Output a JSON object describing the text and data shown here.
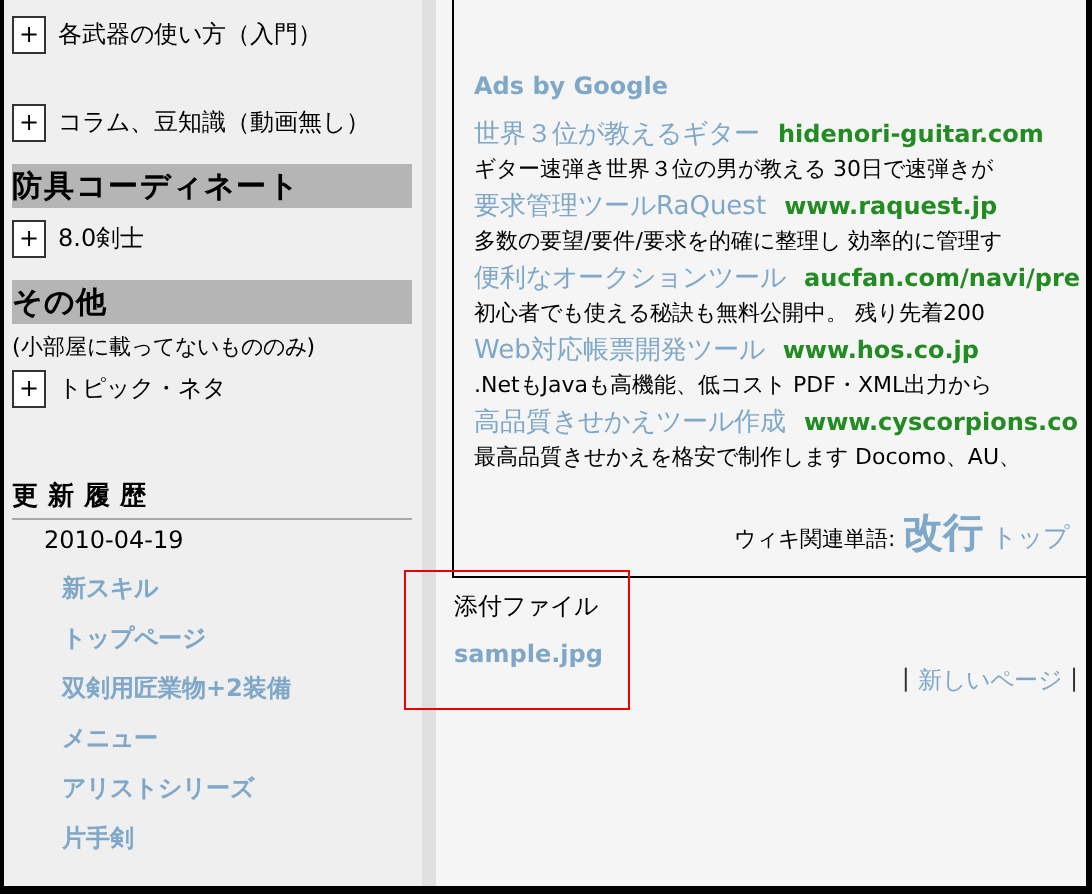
{
  "sidebar": {
    "blocks": [
      {
        "kind": "expander",
        "toggle": "+",
        "label": "各武器の使い方（入門）"
      },
      {
        "kind": "expander",
        "toggle": "+",
        "label": "コラム、豆知識（動画無し）"
      },
      {
        "kind": "heading",
        "label": "防具コーディネート"
      },
      {
        "kind": "expander",
        "toggle": "+",
        "label": "8.0剣士"
      },
      {
        "kind": "heading",
        "label": "その他"
      },
      {
        "kind": "note",
        "label": "(小部屋に載ってないもののみ)"
      },
      {
        "kind": "expander",
        "toggle": "+",
        "label": "トピック・ネタ"
      }
    ],
    "history": {
      "title": "更新履歴",
      "date": "2010-04-19",
      "links": [
        "新スキル",
        "トップページ",
        "双剣用匠業物+2装備",
        "メニュー",
        "アリストシリーズ",
        "片手剣"
      ]
    }
  },
  "ads": {
    "label": "Ads by Google",
    "items": [
      {
        "title": "世界３位が教えるギター",
        "url": "hidenori-guitar.com",
        "description": "ギター速弾き世界３位の男が教える 30日で速弾きが"
      },
      {
        "title": "要求管理ツールRaQuest",
        "url": "www.raquest.jp",
        "description": "多数の要望/要件/要求を的確に整理し 効率的に管理す"
      },
      {
        "title": "便利なオークションツール",
        "url": "aucfan.com/navi/pre",
        "description": "初心者でも使える秘訣も無料公開中。 残り先着200"
      },
      {
        "title": "Web対応帳票開発ツール",
        "url": "www.hos.co.jp",
        "description": ".NetもJavaも高機能、低コスト PDF・XML出力から"
      },
      {
        "title": "高品質きせかえツール作成",
        "url": "www.cyscorpions.co",
        "description": "最高品質きせかえを格安で制作します Docomo、AU、"
      }
    ],
    "related": {
      "label": "ウィキ関連単語:",
      "words": [
        {
          "text": "改行",
          "kind": "large"
        },
        {
          "text": "トップ",
          "kind": "small"
        }
      ]
    }
  },
  "attachments": {
    "title": "添付ファイル",
    "files": [
      "sample.jpg"
    ]
  },
  "footer": {
    "items": [
      {
        "kind": "separator",
        "text": "|"
      },
      {
        "kind": "link",
        "text": "新しいページ"
      },
      {
        "kind": "separator",
        "text": "|"
      }
    ]
  }
}
